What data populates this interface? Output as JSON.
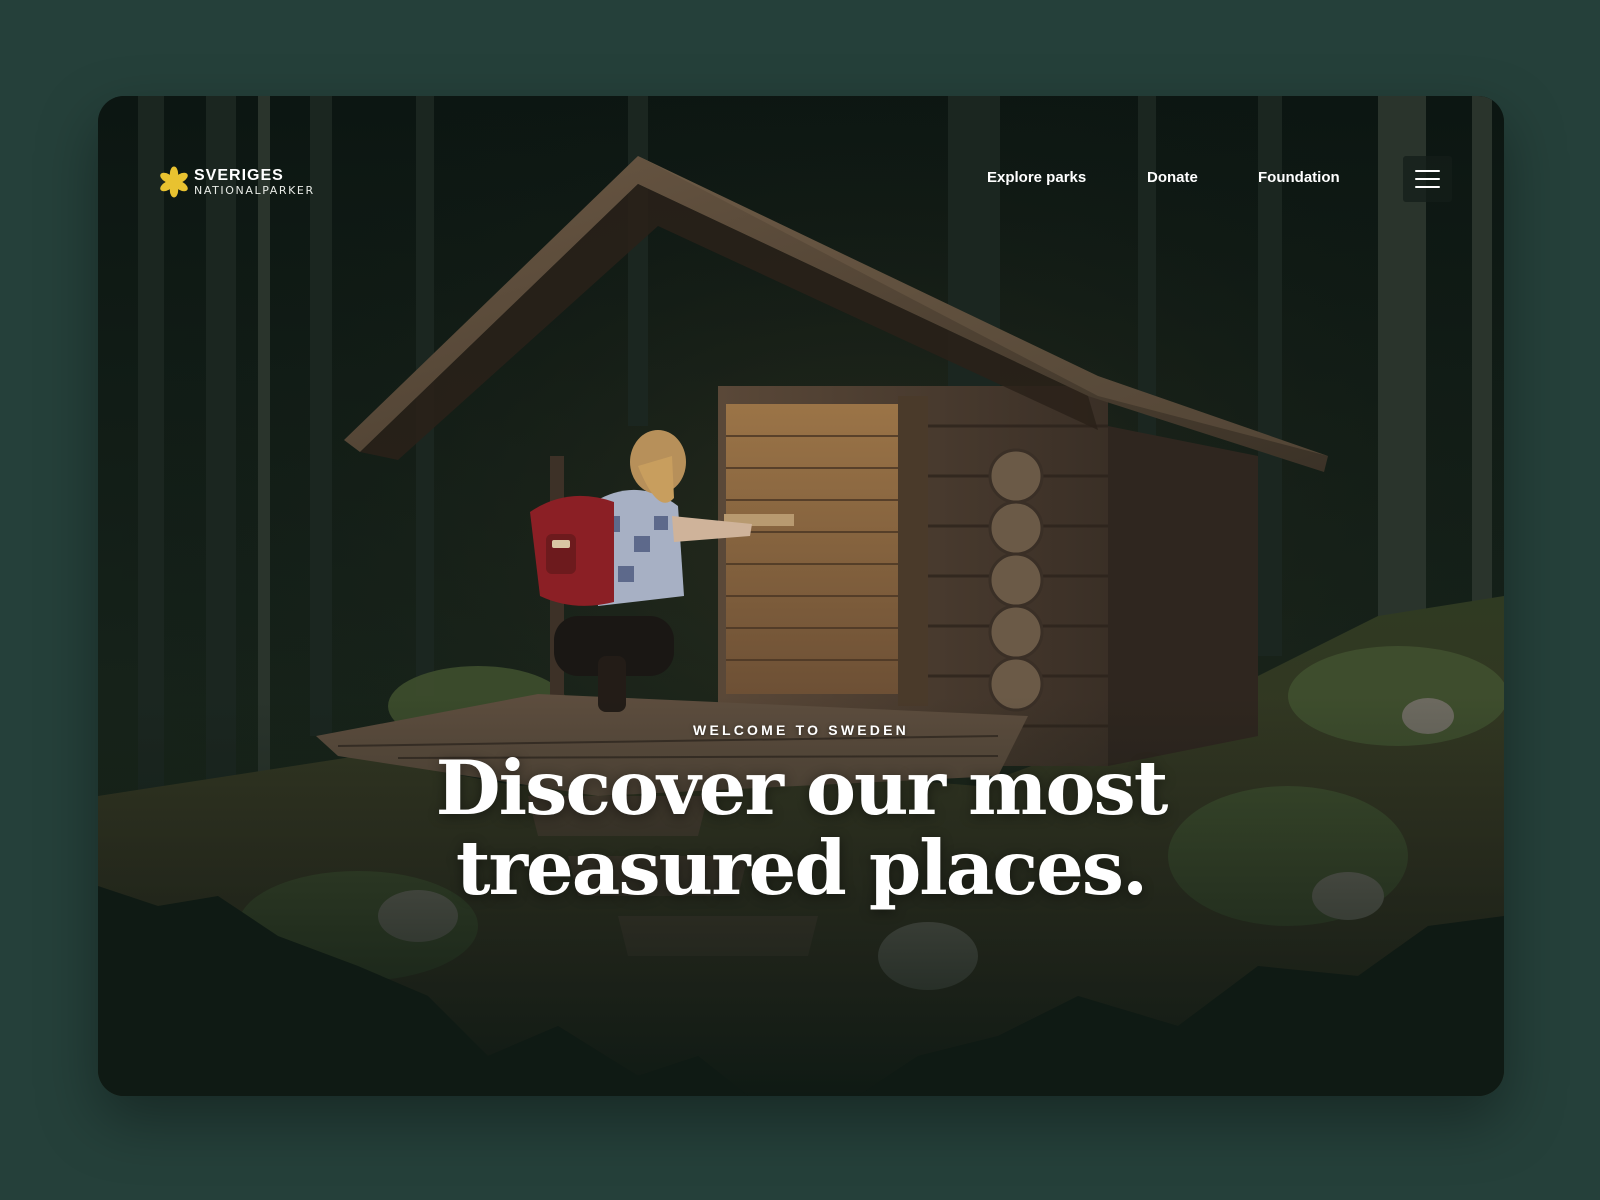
{
  "brand": {
    "line1": "SVERIGES",
    "line2": "NATIONALPARKER",
    "icon": "flower-asterisk-icon",
    "icon_color": "#e8c230"
  },
  "nav": {
    "items": [
      {
        "label": "Explore parks"
      },
      {
        "label": "Donate"
      },
      {
        "label": "Foundation"
      }
    ],
    "menu_icon": "hamburger-menu-icon"
  },
  "hero": {
    "eyebrow": "WELCOME TO SWEDEN",
    "headline_line1": "Discover our most",
    "headline_line2": "treasured places."
  },
  "colors": {
    "page_background": "#25403a",
    "card_background": "#0f1a14",
    "text": "#ffffff"
  }
}
